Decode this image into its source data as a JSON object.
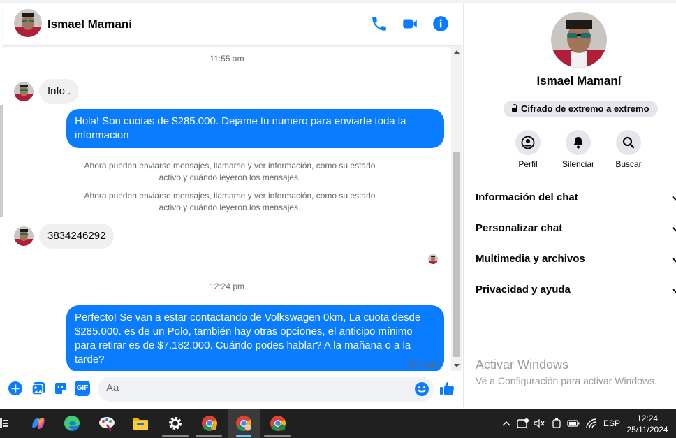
{
  "header": {
    "contact_name": "Ismael Mamaní",
    "call_icon": "phone-icon",
    "video_icon": "video-camera-icon",
    "info_icon": "info-icon"
  },
  "conversation": {
    "time1": "11:55 am",
    "msg_in_1": "Info .",
    "msg_out_1": "Hola! Son cuotas de $285.000. Dejame tu numero para enviarte toda la informacion",
    "system_note_1": "Ahora pueden enviarse mensajes, llamarse y ver información, como su estado activo y cuándo leyeron los mensajes.",
    "system_note_2": "Ahora pueden enviarse mensajes, llamarse y ver información, como su estado activo y cuándo leyeron los mensajes.",
    "msg_in_2": "3834246292",
    "time2": "12:24 pm",
    "msg_out_2": "Perfecto!  Se van a estar contactando de Volkswagen 0km, La cuota desde $285.000. es de un Polo, también hay otras opciones, el anticipo mínimo para retirar es de $7.182.000. Cuándo podes hablar? A la mañana o a la tarde?",
    "status": "Enviado"
  },
  "composer": {
    "placeholder": "Aa",
    "icons": [
      "plus-icon",
      "image-icon",
      "sticker-icon",
      "gif-icon",
      "emoji-icon",
      "like-icon"
    ],
    "gif_label": "GIF"
  },
  "side_panel": {
    "name": "Ismael Mamaní",
    "encryption": "Cifrado de extremo a extremo",
    "actions": [
      {
        "label": "Perfil",
        "icon": "profile-icon"
      },
      {
        "label": "Silenciar",
        "icon": "bell-icon"
      },
      {
        "label": "Buscar",
        "icon": "search-icon"
      }
    ],
    "menu": [
      {
        "label": "Información del chat"
      },
      {
        "label": "Personalizar chat"
      },
      {
        "label": "Multimedia y archivos"
      },
      {
        "label": "Privacidad y ayuda"
      }
    ],
    "watermark_title": "Activar Windows",
    "watermark_sub": "Ve a Configuración para activar Windows."
  },
  "taskbar": {
    "language": "ESP",
    "time": "12:24",
    "date": "25/11/2024"
  },
  "colors": {
    "accent": "#0a7cff",
    "bubble_in": "#f0f0f0",
    "taskbar": "#202020"
  }
}
